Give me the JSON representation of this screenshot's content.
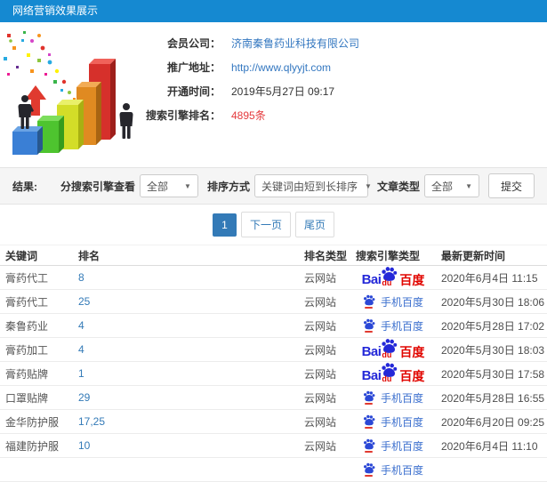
{
  "header": {
    "title": "网络营销效果展示"
  },
  "info": {
    "fields": [
      {
        "label": "会员公司：",
        "value": "济南秦鲁药业科技有限公司"
      },
      {
        "label": "推广地址：",
        "value": "http://www.qlyyjt.com"
      },
      {
        "label": "开通时间：",
        "value": "2019年5月27日 09:17"
      },
      {
        "label": "搜索引擎排名：",
        "value": "4895条"
      }
    ]
  },
  "filters": {
    "result_label": "结果:",
    "engine_label": "分搜索引擎查看",
    "engine_value": "全部",
    "sort_label": "排序方式",
    "sort_value": "关键词由短到长排序",
    "article_label": "文章类型",
    "article_value": "全部",
    "submit_label": "提交",
    "caret": "▼"
  },
  "pagination": {
    "current": "1",
    "next": "下一页",
    "last": "尾页"
  },
  "brand": {
    "bai": "Bai",
    "du": "du",
    "baidu_cn": "百度",
    "mobile_label": "手机百度"
  },
  "table": {
    "headers": [
      "关键词",
      "排名",
      "排名类型",
      "搜索引擎类型",
      "最新更新时间"
    ],
    "rows": [
      {
        "keyword": "膏药代工",
        "rank": "8",
        "rank_type": "云网站",
        "engine": "baidu-pc",
        "time": "2020年6月4日 11:15"
      },
      {
        "keyword": "膏药代工",
        "rank": "25",
        "rank_type": "云网站",
        "engine": "baidu-mobile",
        "time": "2020年5月30日 18:06"
      },
      {
        "keyword": "秦鲁药业",
        "rank": "4",
        "rank_type": "云网站",
        "engine": "baidu-mobile",
        "time": "2020年5月28日 17:02"
      },
      {
        "keyword": "膏药加工",
        "rank": "4",
        "rank_type": "云网站",
        "engine": "baidu-pc",
        "time": "2020年5月30日 18:03"
      },
      {
        "keyword": "膏药贴牌",
        "rank": "1",
        "rank_type": "云网站",
        "engine": "baidu-pc",
        "time": "2020年5月30日 17:58"
      },
      {
        "keyword": "口罩贴牌",
        "rank": "29",
        "rank_type": "云网站",
        "engine": "baidu-mobile",
        "time": "2020年5月28日 16:55"
      },
      {
        "keyword": "金华防护服",
        "rank": "17,25",
        "rank_type": "云网站",
        "engine": "baidu-mobile",
        "time": "2020年6月20日 09:25"
      },
      {
        "keyword": "福建防护服",
        "rank": "10",
        "rank_type": "云网站",
        "engine": "baidu-mobile",
        "time": "2020年6月4日 11:10"
      },
      {
        "keyword": "",
        "rank": "",
        "rank_type": "",
        "engine": "baidu-mobile",
        "time": ""
      }
    ]
  },
  "colors": {
    "header_bg": "#1589d1",
    "accent_blue": "#337ab7",
    "link_blue": "#3377c0",
    "highlight_red": "#e4393c",
    "baidu_blue": "#2428d8",
    "baidu_red": "#e10601"
  }
}
